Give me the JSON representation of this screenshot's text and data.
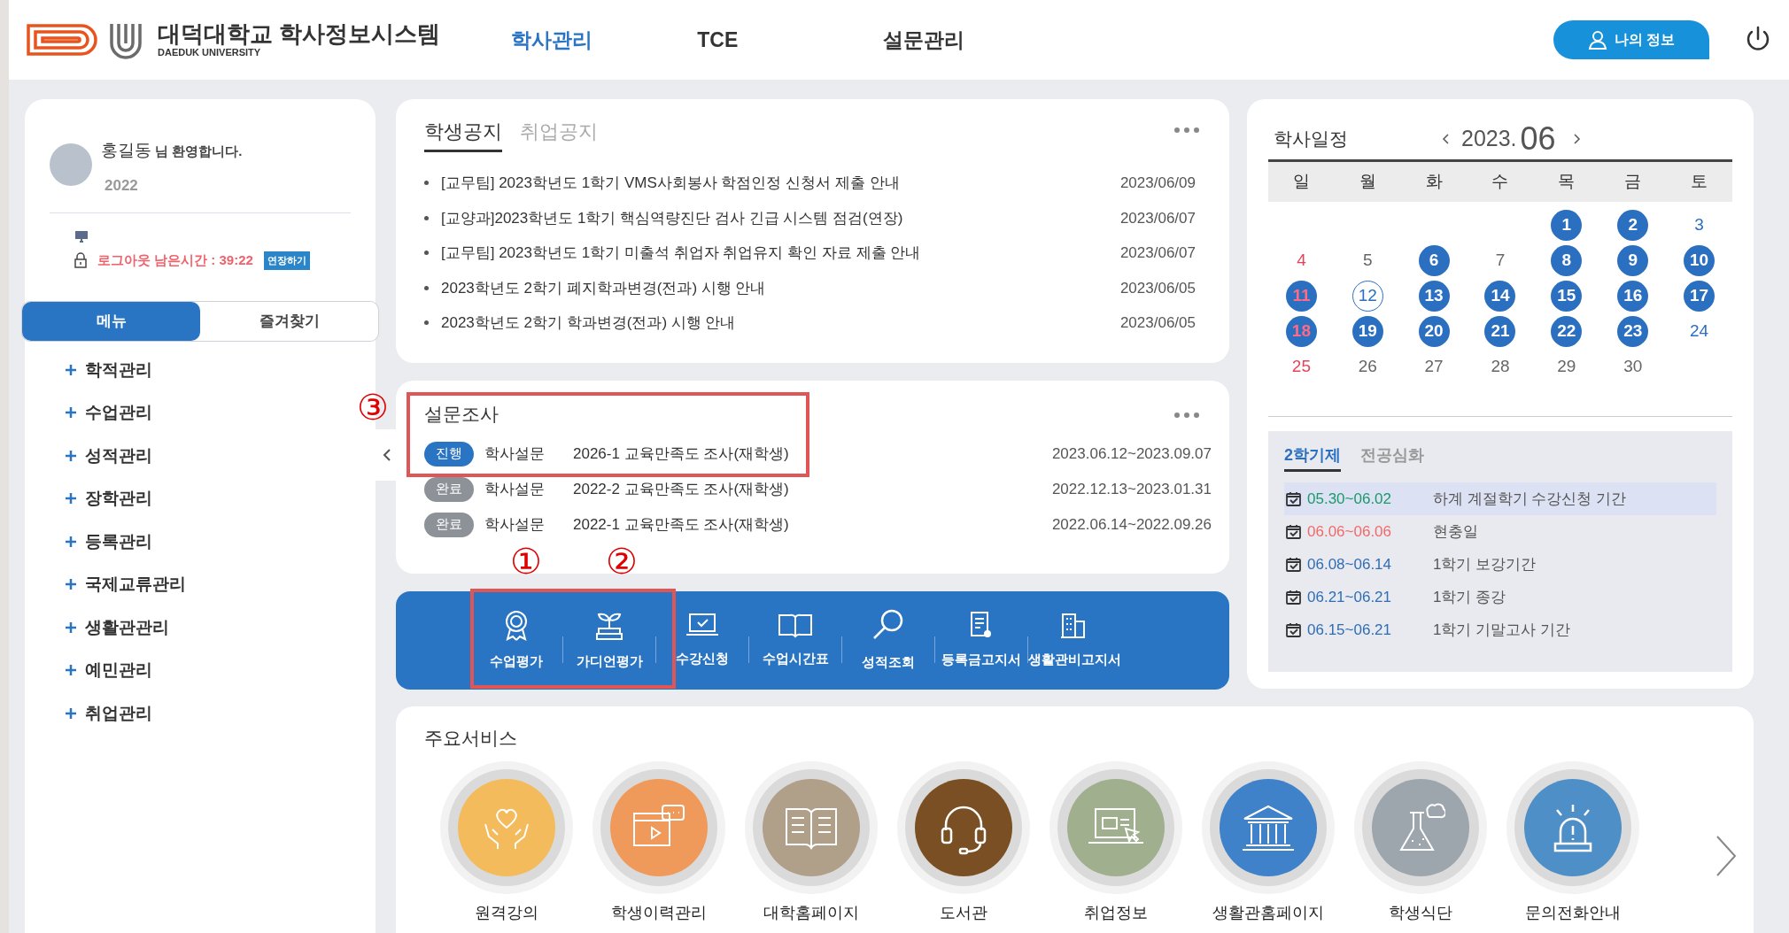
{
  "header": {
    "title": "대덕대학교 학사정보시스템",
    "subtitle": "DAEDUK UNIVERSITY",
    "nav": [
      {
        "label": "학사관리",
        "selected": true
      },
      {
        "label": "TCE",
        "selected": false
      },
      {
        "label": "설문관리",
        "selected": false
      }
    ],
    "profile_button": "나의 정보"
  },
  "sidebar": {
    "user_name": "홍길동",
    "greeting": "님 환영합니다.",
    "year": "2022",
    "logout_timer": "로그아웃 남은시간 : 39:22",
    "extend_button": "연장하기",
    "tabs": [
      {
        "label": "메뉴",
        "selected": true
      },
      {
        "label": "즐겨찾기",
        "selected": false
      }
    ],
    "items": [
      "학적관리",
      "수업관리",
      "성적관리",
      "장학관리",
      "등록관리",
      "국제교류관리",
      "생활관관리",
      "예민관리",
      "취업관리"
    ]
  },
  "notices": {
    "tabs": [
      {
        "label": "학생공지",
        "selected": true
      },
      {
        "label": "취업공지",
        "selected": false
      }
    ],
    "rows": [
      {
        "title": "[교무팀] 2023학년도 1학기 VMS사회봉사 학점인정 신청서 제출 안내",
        "date": "2023/06/09"
      },
      {
        "title": "[교양과]2023학년도 1학기 핵심역량진단 검사 긴급 시스템 점검(연장)",
        "date": "2023/06/07"
      },
      {
        "title": "[교무팀] 2023학년도 1학기 미출석 취업자 취업유지 확인 자료 제출 안내",
        "date": "2023/06/07"
      },
      {
        "title": "2023학년도 2학기 폐지학과변경(전과) 시행 안내",
        "date": "2023/06/05"
      },
      {
        "title": "2023학년도 2학기 학과변경(전과) 시행 안내",
        "date": "2023/06/05"
      }
    ]
  },
  "survey": {
    "title": "설문조사",
    "rows": [
      {
        "status": "진행",
        "kind": "ongoing",
        "category": "학사설문",
        "title": "2026-1 교육만족도 조사(재학생)",
        "period": "2023.06.12~2023.09.07"
      },
      {
        "status": "완료",
        "kind": "done",
        "category": "학사설문",
        "title": "2022-2 교육만족도 조사(재학생)",
        "period": "2022.12.13~2023.01.31"
      },
      {
        "status": "완료",
        "kind": "done",
        "category": "학사설문",
        "title": "2022-1 교육만족도 조사(재학생)",
        "period": "2022.06.14~2022.09.26"
      }
    ]
  },
  "quick_menu": [
    "수업평가",
    "가디언평가",
    "수강신청",
    "수업시간표",
    "성적조회",
    "등록금고지서",
    "생활관비고지서"
  ],
  "calendar": {
    "title": "학사일정",
    "year": "2023.",
    "month": "06",
    "weekdays": [
      "일",
      "월",
      "화",
      "수",
      "목",
      "금",
      "토"
    ],
    "weeks": [
      [
        {
          "day": "1",
          "marked": true,
          "today": false
        },
        {
          "day": "2",
          "marked": true,
          "today": false
        },
        {
          "day": "3",
          "marked": false,
          "today": false
        }
      ],
      [
        {
          "day": "4",
          "marked": false,
          "today": false
        },
        {
          "day": "5",
          "marked": false,
          "today": false
        },
        {
          "day": "6",
          "marked": true,
          "today": false
        },
        {
          "day": "7",
          "marked": false,
          "today": false
        },
        {
          "day": "8",
          "marked": true,
          "today": false
        },
        {
          "day": "9",
          "marked": true,
          "today": false
        },
        {
          "day": "10",
          "marked": true,
          "today": false
        }
      ],
      [
        {
          "day": "11",
          "marked": true,
          "today": false
        },
        {
          "day": "12",
          "marked": false,
          "today": true
        },
        {
          "day": "13",
          "marked": true,
          "today": false
        },
        {
          "day": "14",
          "marked": true,
          "today": false
        },
        {
          "day": "15",
          "marked": true,
          "today": false
        },
        {
          "day": "16",
          "marked": true,
          "today": false
        },
        {
          "day": "17",
          "marked": true,
          "today": false
        }
      ],
      [
        {
          "day": "18",
          "marked": true,
          "today": false
        },
        {
          "day": "19",
          "marked": true,
          "today": false
        },
        {
          "day": "20",
          "marked": true,
          "today": false
        },
        {
          "day": "21",
          "marked": true,
          "today": false
        },
        {
          "day": "22",
          "marked": true,
          "today": false
        },
        {
          "day": "23",
          "marked": true,
          "today": false
        },
        {
          "day": "24",
          "marked": false,
          "today": false
        }
      ],
      [
        {
          "day": "25",
          "marked": false,
          "today": false
        },
        {
          "day": "26",
          "marked": false,
          "today": false
        },
        {
          "day": "27",
          "marked": false,
          "today": false
        },
        {
          "day": "28",
          "marked": false,
          "today": false
        },
        {
          "day": "29",
          "marked": false,
          "today": false
        },
        {
          "day": "30",
          "marked": false,
          "today": false
        }
      ]
    ],
    "tabs": [
      {
        "label": "2학기제",
        "selected": true
      },
      {
        "label": "전공심화",
        "selected": false
      }
    ],
    "events": [
      {
        "period": "05.30~06.02",
        "title": "하계 계절학기 수강신청 기간",
        "color": "#1a9a6a",
        "selected": true
      },
      {
        "period": "06.06~06.06",
        "title": "현충일",
        "color": "#f06a6a",
        "selected": false
      },
      {
        "period": "06.08~06.14",
        "title": "1학기 보강기간",
        "color": "#2f6db5",
        "selected": false
      },
      {
        "period": "06.21~06.21",
        "title": "1학기 종강",
        "color": "#2f6db5",
        "selected": false
      },
      {
        "period": "06.15~06.21",
        "title": "1학기 기말고사 기간",
        "color": "#2f6db5",
        "selected": false
      }
    ]
  },
  "services": {
    "title": "주요서비스",
    "items": [
      {
        "label": "원격강의",
        "color": "#f3bb5c"
      },
      {
        "label": "학생이력관리",
        "color": "#ef9a5a"
      },
      {
        "label": "대학홈페이지",
        "color": "#b09f89"
      },
      {
        "label": "도서관",
        "color": "#7a4f23"
      },
      {
        "label": "취업정보",
        "color": "#a0af8d"
      },
      {
        "label": "생활관홈페이지",
        "color": "#3f82c9"
      },
      {
        "label": "학생식단",
        "color": "#9ea6ad"
      },
      {
        "label": "문의전화안내",
        "color": "#4f8fc8"
      }
    ]
  },
  "annotations": [
    "①",
    "②",
    "③"
  ]
}
